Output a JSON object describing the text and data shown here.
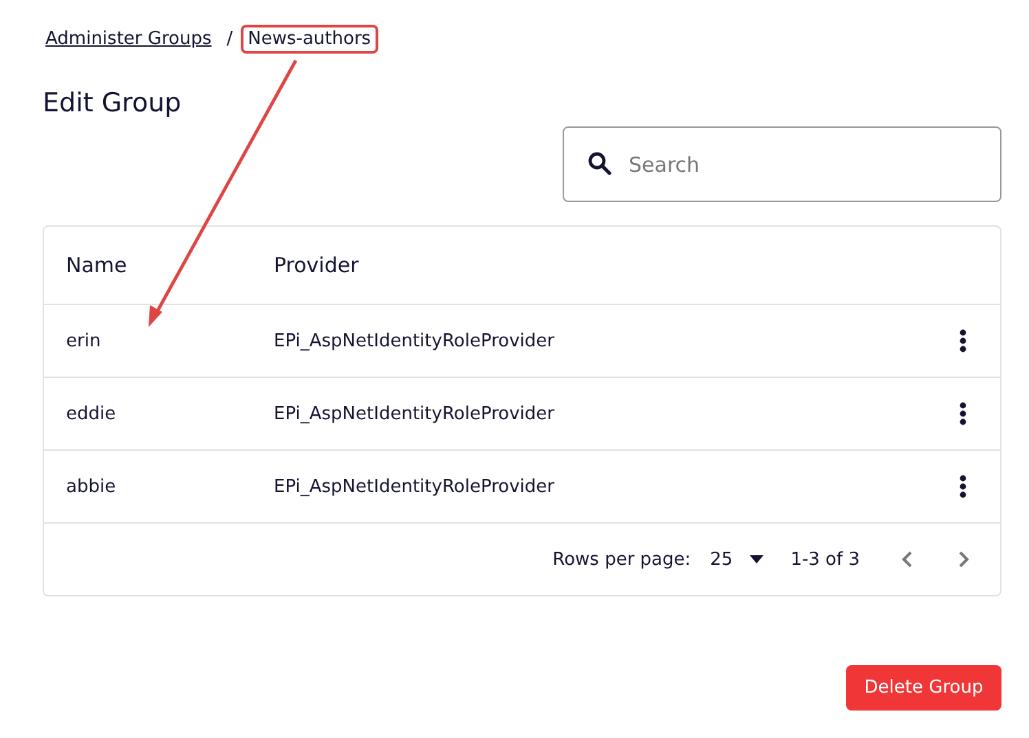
{
  "breadcrumb": [
    {
      "label": "Administer Groups",
      "link": true,
      "highlighted": false
    },
    {
      "label": "News-authors",
      "link": false,
      "highlighted": true
    }
  ],
  "breadcrumb_separator": "/",
  "title": "Edit Group",
  "search": {
    "placeholder": "Search"
  },
  "annotation": {
    "kind": "arrow"
  },
  "table": {
    "columns": [
      "Name",
      "Provider"
    ],
    "rows": [
      {
        "name": "erin",
        "provider": "EPi_AspNetIdentityRoleProvider"
      },
      {
        "name": "eddie",
        "provider": "EPi_AspNetIdentityRoleProvider"
      },
      {
        "name": "abbie",
        "provider": "EPi_AspNetIdentityRoleProvider"
      }
    ]
  },
  "pagination": {
    "rows_per_page_label": "Rows per page:",
    "rows_per_page": "25",
    "range": "1-3 of 3"
  },
  "buttons": [
    "Delete Group"
  ]
}
